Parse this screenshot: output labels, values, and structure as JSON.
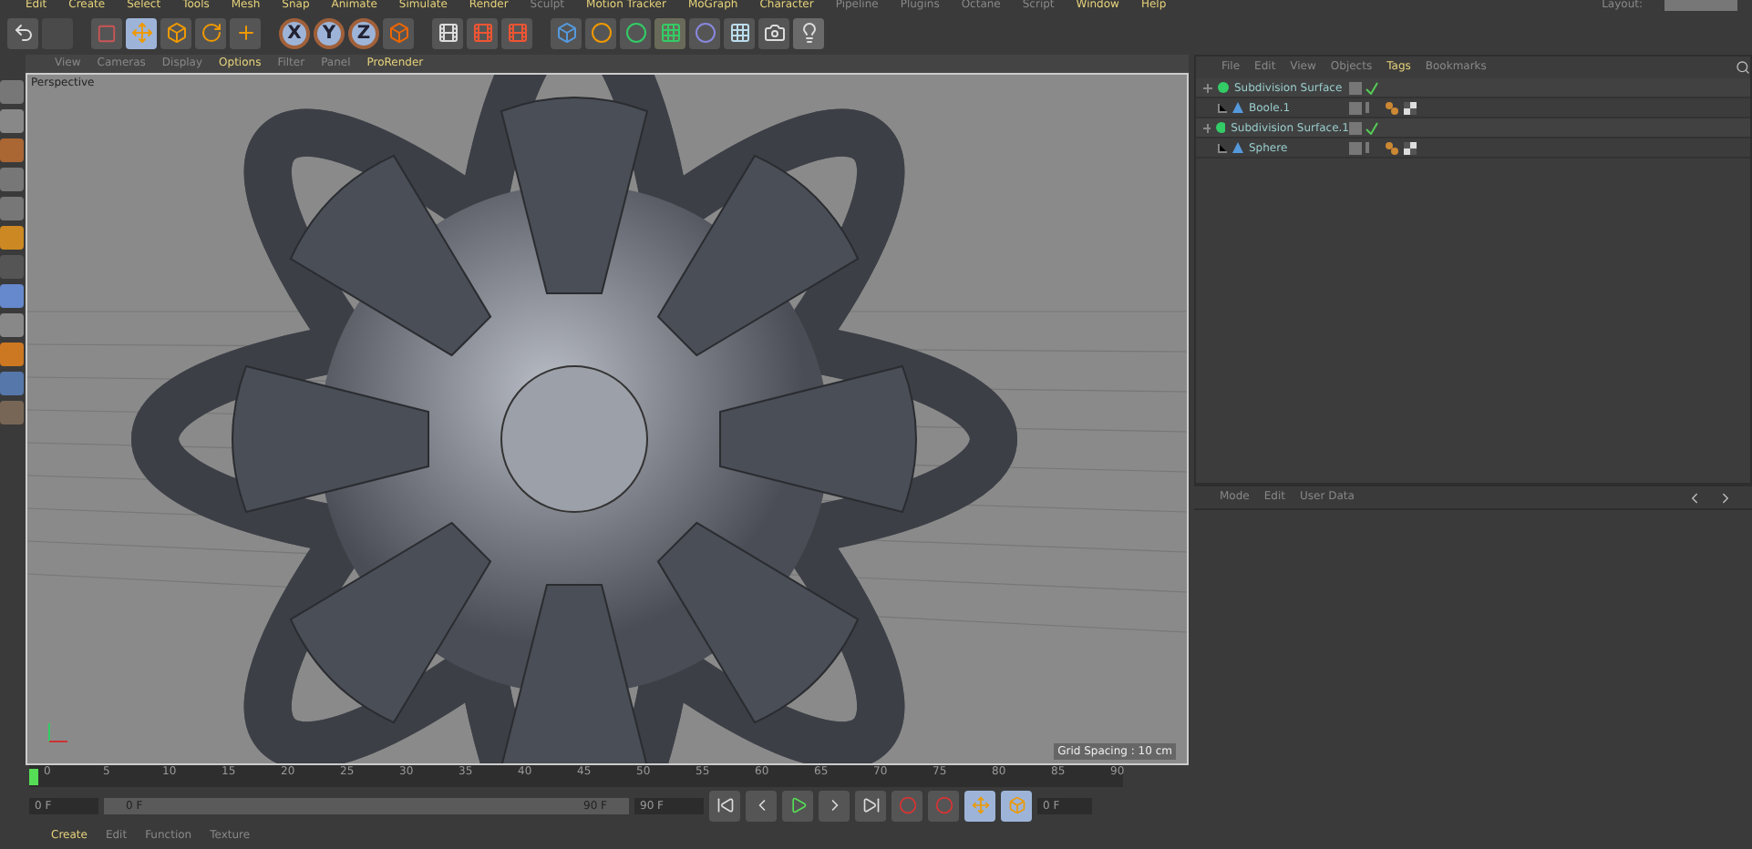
{
  "menu_bar": [
    "Edit",
    "Create",
    "Select",
    "Tools",
    "Mesh",
    "Snap",
    "Animate",
    "Simulate",
    "Render",
    "Sculpt",
    "Motion Tracker",
    "MoGraph",
    "Character",
    "Pipeline",
    "Plugins",
    "Octane",
    "Script",
    "Window",
    "Help"
  ],
  "layout_label": "Layout:",
  "axis_buttons": [
    "X",
    "Y",
    "Z"
  ],
  "viewport": {
    "menu": [
      {
        "label": "View",
        "highlighted": false
      },
      {
        "label": "Cameras",
        "highlighted": false
      },
      {
        "label": "Display",
        "highlighted": false
      },
      {
        "label": "Options",
        "highlighted": true
      },
      {
        "label": "Filter",
        "highlighted": false
      },
      {
        "label": "Panel",
        "highlighted": false
      },
      {
        "label": "ProRender",
        "highlighted": true
      }
    ],
    "camera": "Perspective",
    "grid_spacing": "Grid Spacing : 10 cm"
  },
  "object_manager": {
    "menu": [
      {
        "label": "File",
        "selected": false
      },
      {
        "label": "Edit",
        "selected": false
      },
      {
        "label": "View",
        "selected": false
      },
      {
        "label": "Objects",
        "selected": false
      },
      {
        "label": "Tags",
        "selected": true
      },
      {
        "label": "Bookmarks",
        "selected": false
      }
    ],
    "objects": [
      {
        "name": "Subdivision Surface",
        "kind": "generator",
        "enabled": true,
        "expanded": true,
        "children": [
          {
            "name": "Boole.1",
            "kind": "primitive",
            "enabled": false,
            "expanded": false
          }
        ]
      },
      {
        "name": "Subdivision Surface.1",
        "kind": "generator",
        "enabled": true,
        "expanded": true,
        "children": [
          {
            "name": "Sphere",
            "kind": "primitive",
            "enabled": false,
            "expanded": false
          }
        ]
      }
    ]
  },
  "attributes": {
    "menu": [
      "Mode",
      "Edit",
      "User Data"
    ]
  },
  "timeline": {
    "ticks": [
      "0",
      "5",
      "10",
      "15",
      "20",
      "25",
      "30",
      "35",
      "40",
      "45",
      "50",
      "55",
      "60",
      "65",
      "70",
      "75",
      "80",
      "85",
      "90"
    ],
    "current_frame": "0 F",
    "start": "0 F",
    "range": {
      "start": "0 F",
      "end": "90 F",
      "level": 1
    },
    "end": "90 F",
    "level": 0
  },
  "material_menu": [
    "Create",
    "Edit",
    "Function",
    "Texture"
  ]
}
